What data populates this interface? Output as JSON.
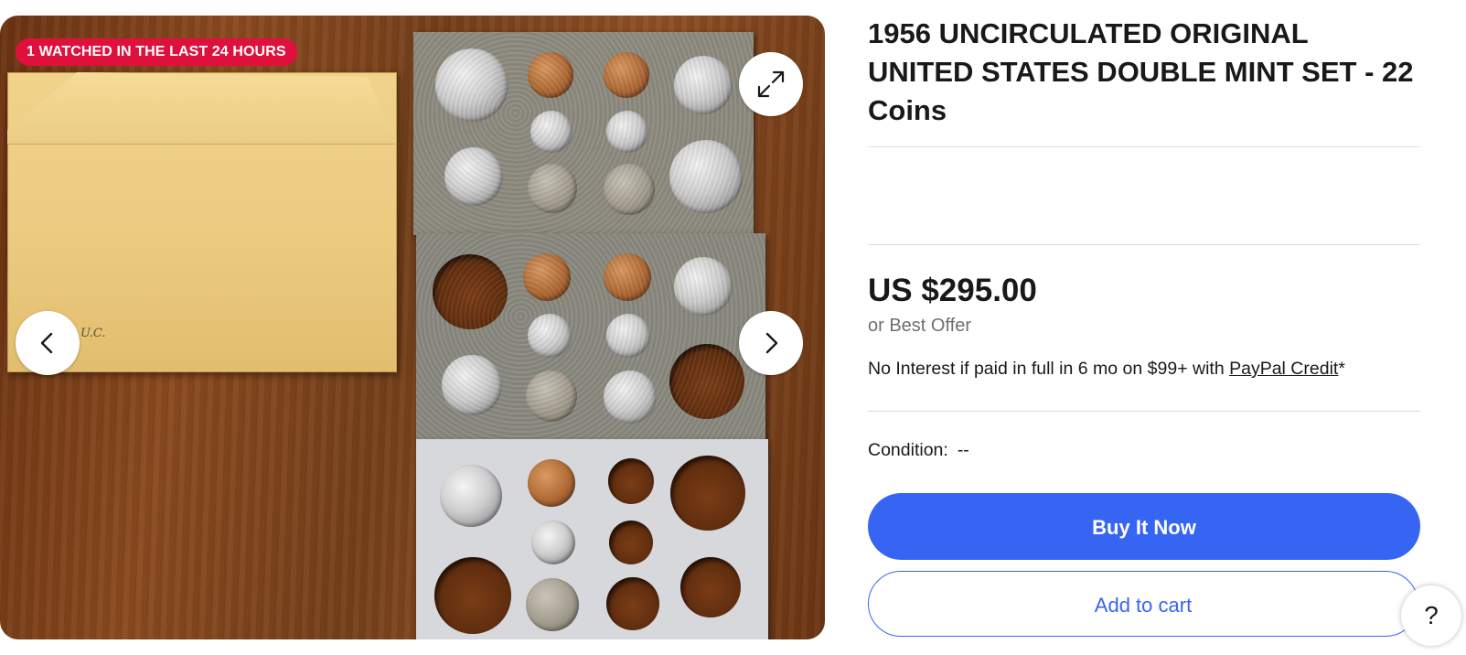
{
  "gallery": {
    "badge": "1 WATCHED IN THE LAST 24 HOURS",
    "envelope_note": "U.C.",
    "prev_icon": "chevron-left-icon",
    "next_icon": "chevron-right-icon",
    "expand_icon": "expand-icon"
  },
  "listing": {
    "title": "1956 UNCIRCULATED ORIGINAL UNITED STATES DOUBLE MINT SET - 22 Coins",
    "price": "US $295.00",
    "best_offer": "or Best Offer",
    "financing_text": "No Interest if paid in full in 6 mo on $99+ with ",
    "financing_link": "PayPal Credit",
    "financing_suffix": "*",
    "condition_label": "Condition:",
    "condition_value": "--"
  },
  "actions": {
    "buy_now": "Buy It Now",
    "add_to_cart": "Add to cart"
  },
  "help": {
    "label": "?"
  },
  "colors": {
    "badge": "#e0103d",
    "primary": "#3665f3",
    "text": "#191919",
    "muted": "#707070"
  }
}
